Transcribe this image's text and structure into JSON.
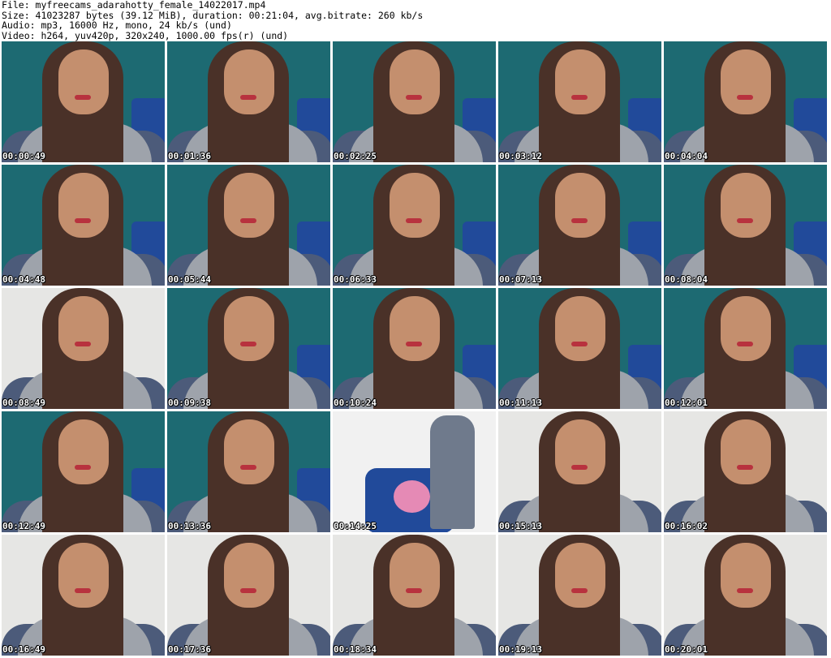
{
  "header": {
    "file": "File: myfreecams_adarahotty_female_14022017.mp4",
    "size": "Size: 41023287 bytes (39.12 MiB), duration: 00:21:04, avg.bitrate: 260 kb/s",
    "audio": "Audio: mp3, 16000 Hz, mono, 24 kb/s (und)",
    "video": "Video: h264, yuv420p, 320x240, 1000.00 fps(r) (und)"
  },
  "thumbnails": [
    {
      "timestamp": "00:00:49",
      "scene": "teal-wall"
    },
    {
      "timestamp": "00:01:36",
      "scene": "teal-wall"
    },
    {
      "timestamp": "00:02:25",
      "scene": "teal-wall"
    },
    {
      "timestamp": "00:03:12",
      "scene": "teal-wall"
    },
    {
      "timestamp": "00:04:04",
      "scene": "teal-wall"
    },
    {
      "timestamp": "00:04:48",
      "scene": "teal-wall"
    },
    {
      "timestamp": "00:05:44",
      "scene": "teal-wall"
    },
    {
      "timestamp": "00:06:33",
      "scene": "teal-wall"
    },
    {
      "timestamp": "00:07:13",
      "scene": "teal-wall"
    },
    {
      "timestamp": "00:08:04",
      "scene": "teal-wall"
    },
    {
      "timestamp": "00:08:49",
      "scene": "white-wall"
    },
    {
      "timestamp": "00:09:38",
      "scene": "teal-wall"
    },
    {
      "timestamp": "00:10:24",
      "scene": "teal-wall"
    },
    {
      "timestamp": "00:11:13",
      "scene": "teal-wall"
    },
    {
      "timestamp": "00:12:01",
      "scene": "teal-wall"
    },
    {
      "timestamp": "00:12:49",
      "scene": "teal-wall"
    },
    {
      "timestamp": "00:13:36",
      "scene": "teal-wall"
    },
    {
      "timestamp": "00:14:25",
      "scene": "room-chair"
    },
    {
      "timestamp": "00:15:13",
      "scene": "white-wall"
    },
    {
      "timestamp": "00:16:02",
      "scene": "white-wall"
    },
    {
      "timestamp": "00:16:49",
      "scene": "white-wall"
    },
    {
      "timestamp": "00:17:36",
      "scene": "white-wall"
    },
    {
      "timestamp": "00:18:34",
      "scene": "white-wall"
    },
    {
      "timestamp": "00:19:13",
      "scene": "white-wall"
    },
    {
      "timestamp": "00:20:01",
      "scene": "white-wall"
    }
  ],
  "colors": {
    "teal_wall": "#1d6a72",
    "white_wall": "#e6e6e4",
    "room_wall": "#f1f1f1",
    "chair": "#214a9a",
    "timestamp_text": "#ffffff"
  }
}
